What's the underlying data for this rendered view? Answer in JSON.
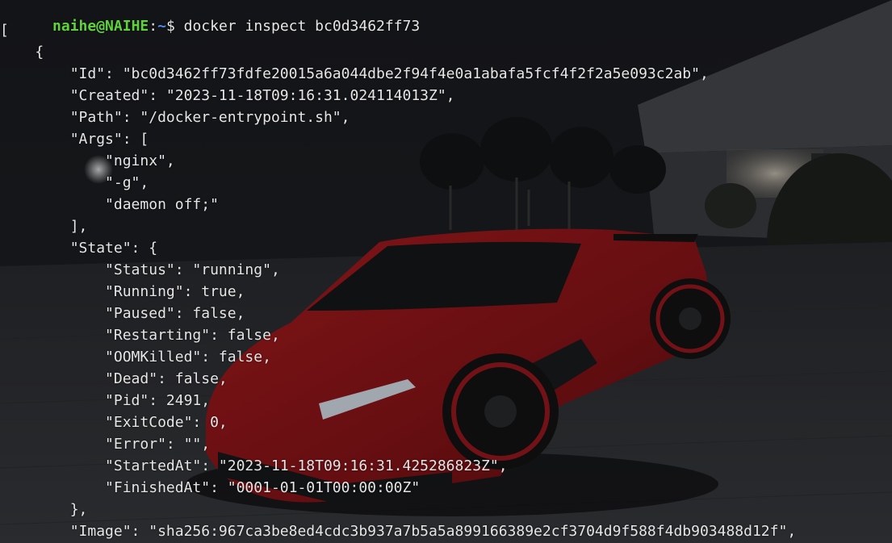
{
  "window": {
    "title": "naihe@NAIHE: ~",
    "theme": {
      "text_color": "#e6e6e6",
      "prompt_user_color": "#5fd33a",
      "prompt_path_color": "#4a8cf0",
      "background_color": "#15171a"
    },
    "background_image": "red-sports-car-wallpaper"
  },
  "prompt": {
    "user_host": "naihe@NAIHE",
    "separator": ":",
    "path": "~",
    "symbol": "$",
    "command": "docker inspect bc0d3462ff73"
  },
  "output_lines": [
    "[",
    "    {",
    "        \"Id\": \"bc0d3462ff73fdfe20015a6a044dbe2f94f4e0a1abafa5fcf4f2f2a5e093c2ab\",",
    "        \"Created\": \"2023-11-18T09:16:31.024114013Z\",",
    "        \"Path\": \"/docker-entrypoint.sh\",",
    "        \"Args\": [",
    "            \"nginx\",",
    "            \"-g\",",
    "            \"daemon off;\"",
    "        ],",
    "        \"State\": {",
    "            \"Status\": \"running\",",
    "            \"Running\": true,",
    "            \"Paused\": false,",
    "            \"Restarting\": false,",
    "            \"OOMKilled\": false,",
    "            \"Dead\": false,",
    "            \"Pid\": 2491,",
    "            \"ExitCode\": 0,",
    "            \"Error\": \"\",",
    "            \"StartedAt\": \"2023-11-18T09:16:31.425286823Z\",",
    "            \"FinishedAt\": \"0001-01-01T00:00:00Z\"",
    "        },",
    "        \"Image\": \"sha256:967ca3be8ed4cdc3b937a7b5a5a899166389e2cf3704d9f588f4db903488d12f\","
  ]
}
